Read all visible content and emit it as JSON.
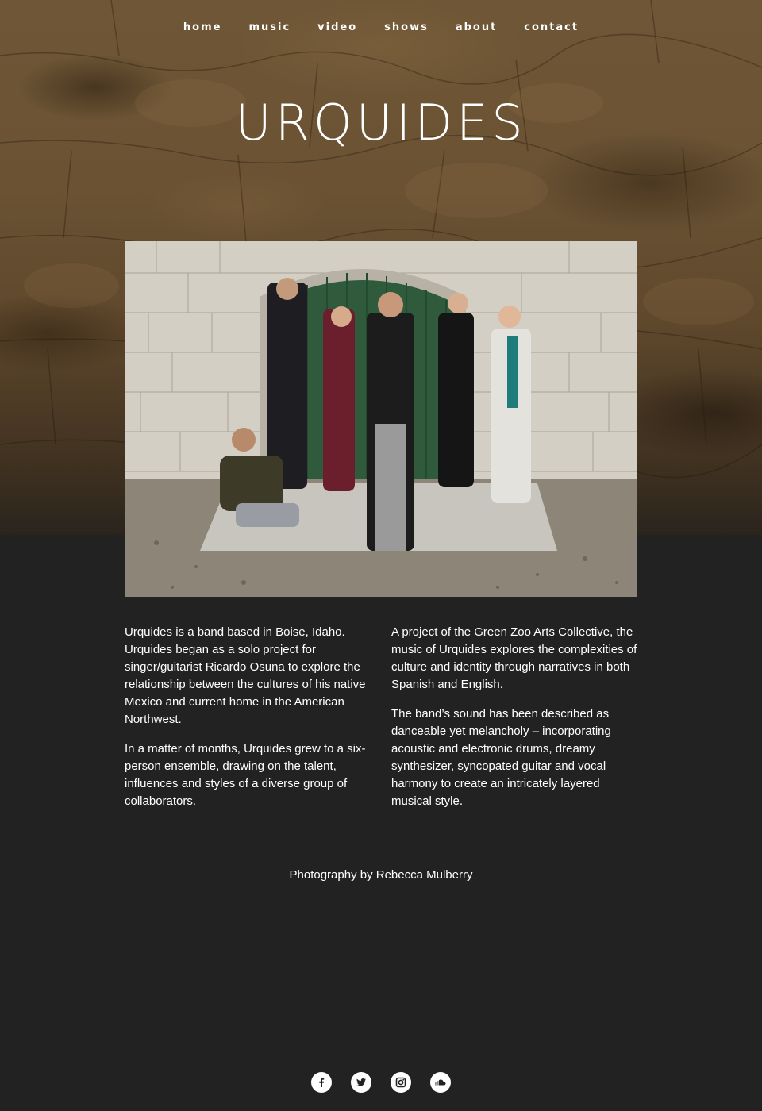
{
  "nav": {
    "items": [
      {
        "label": "home"
      },
      {
        "label": "music"
      },
      {
        "label": "video"
      },
      {
        "label": "shows"
      },
      {
        "label": "about"
      },
      {
        "label": "contact"
      }
    ]
  },
  "site": {
    "title": "URQUIDES"
  },
  "about": {
    "left": [
      "Urquides is a band based in Boise, Idaho. Urquides began as a solo project for singer/guitarist Ricardo Osuna to explore the relationship between the cultures of his native Mexico and current home in the American Northwest.",
      "In a matter of months, Urquides grew to a six-person ensemble, drawing on the talent, influences and styles of a diverse group of collaborators."
    ],
    "right": [
      "A project of the Green Zoo Arts Collective, the music of Urquides explores the complexities of culture and identity through narratives in both Spanish and English.",
      "The band’s sound has been described as danceable yet melancholy – incorporating acoustic and electronic drums, dreamy synthesizer, syncopated guitar and vocal harmony to create an intricately layered musical style."
    ]
  },
  "credit": "Photography by Rebecca Mulberry",
  "social": [
    {
      "icon": "facebook-icon"
    },
    {
      "icon": "twitter-icon"
    },
    {
      "icon": "instagram-icon"
    },
    {
      "icon": "soundcloud-icon"
    }
  ],
  "colors": {
    "background": "#222222",
    "text": "#ffffff",
    "hero_brown": "#6a5233"
  }
}
